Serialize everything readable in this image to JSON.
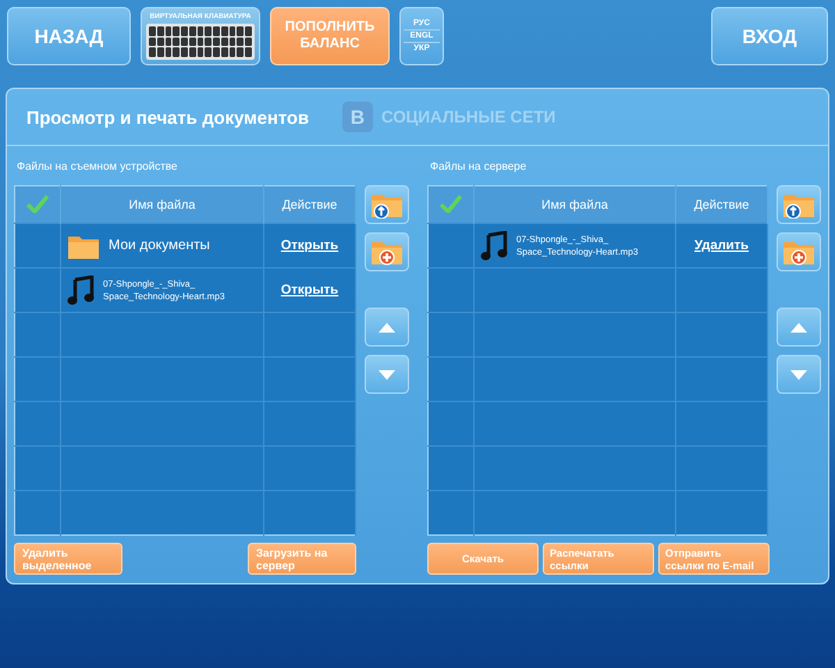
{
  "top_bar": {
    "back_button": "НАЗАД",
    "keyboard_button": "ВИРТУАЛЬНАЯ КЛАВИАТУРА",
    "balance_button": "ПОПОЛНИТЬ БАЛАНС",
    "languages": [
      "РУС",
      "ENGL",
      "УКР"
    ],
    "login_button": "ВХОД"
  },
  "panel": {
    "title": "Просмотр и печать документов",
    "social_logo": "В",
    "social_label": "СОЦИАЛЬНЫЕ СЕТИ"
  },
  "local_files": {
    "label": "Файлы на съемном устройстве",
    "columns": [
      "Имя файла",
      "Действие"
    ],
    "rows": [
      {
        "kind": "folder",
        "name": "Мои документы",
        "action": "Открыть"
      },
      {
        "kind": "audio",
        "name": "07-Shpongle_-_Shiva_ Space_Technology-Heart.mp3",
        "action": "Открыть"
      }
    ],
    "buttons": [
      "Удалить выделенное",
      "Загрузить на сервер"
    ]
  },
  "server_files": {
    "label": "Файлы на сервере",
    "columns": [
      "Имя файла",
      "Действие"
    ],
    "rows": [
      {
        "kind": "audio",
        "name": "07-Shpongle_-_Shiva_ Space_Technology-Heart.mp3",
        "action": "Удалить"
      }
    ],
    "buttons": [
      "Скачать",
      "Распечатать ссылки",
      "Отправить ссылки по E-mail"
    ]
  }
}
